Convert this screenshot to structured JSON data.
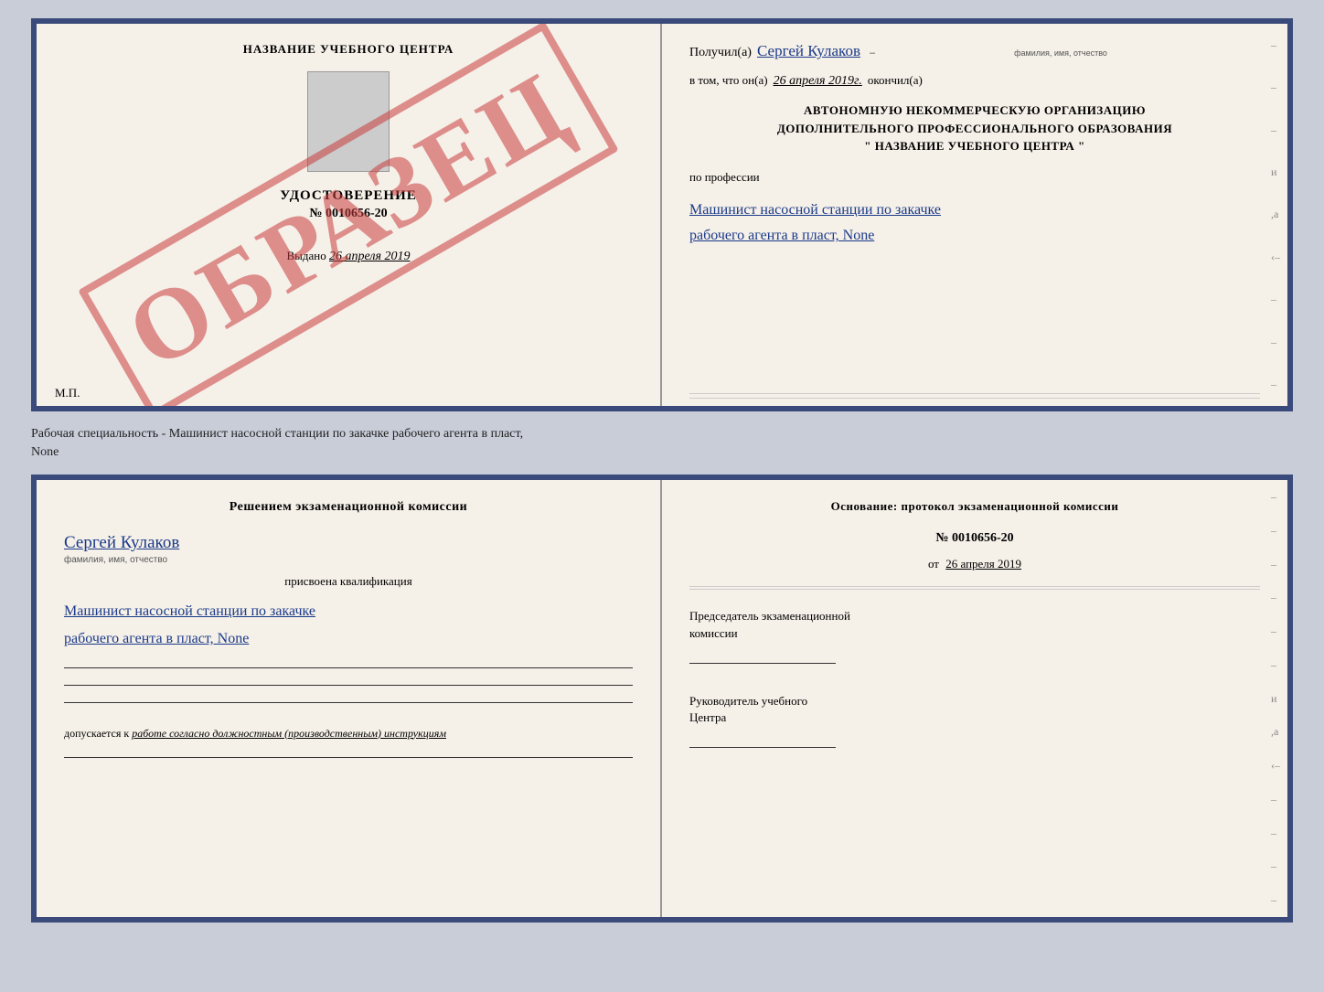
{
  "top_left": {
    "center_title": "НАЗВАНИЕ УЧЕБНОГО ЦЕНТРА",
    "watermark": "ОБРАЗЕЦ",
    "udostoverenie_label": "УДОСТОВЕРЕНИЕ",
    "number": "№ 0010656-20",
    "vydano_label": "Выдано",
    "vydano_date": "26 апреля 2019",
    "mp_label": "М.П."
  },
  "top_right": {
    "poluchil_label": "Получил(а)",
    "poluchil_name": "Сергей Кулаков",
    "familiya_hint": "фамилия, имя, отчество",
    "vtom_label": "в том, что он(а)",
    "vtom_date": "26 апреля 2019г.",
    "okonchil_label": "окончил(а)",
    "avt_line1": "АВТОНОМНУЮ НЕКОММЕРЧЕСКУЮ ОРГАНИЗАЦИЮ",
    "avt_line2": "ДОПОЛНИТЕЛЬНОГО ПРОФЕССИОНАЛЬНОГО ОБРАЗОВАНИЯ",
    "avt_line3": "\"  НАЗВАНИЕ УЧЕБНОГО ЦЕНТРА  \"",
    "po_professii_label": "по профессии",
    "profession_line1": "Машинист насосной станции по закачке",
    "profession_line2": "рабочего агента в пласт, None"
  },
  "caption": {
    "text_line1": "Рабочая специальность - Машинист насосной станции по закачке рабочего агента в пласт,",
    "text_line2": "None"
  },
  "bottom_left": {
    "komissia_line1": "Решением  экзаменационной  комиссии",
    "name": "Сергей Кулаков",
    "familiya_hint": "фамилия, имя, отчество",
    "prisvoena": "присвоена квалификация",
    "profession_line1": "Машинист насосной станции по закачке",
    "profession_line2": "рабочего агента в пласт, None",
    "dopuskaetsya": "допускается к",
    "dopusk_italic": "работе согласно должностным (производственным) инструкциям"
  },
  "bottom_right": {
    "osnovaniye_label": "Основание: протокол экзаменационной  комиссии",
    "number": "№  0010656-20",
    "ot_label": "от",
    "date": "26 апреля 2019",
    "predsedatel_line1": "Председатель экзаменационной",
    "predsedatel_line2": "комиссии",
    "rukovoditel_line1": "Руководитель учебного",
    "rukovoditel_line2": "Центра"
  }
}
